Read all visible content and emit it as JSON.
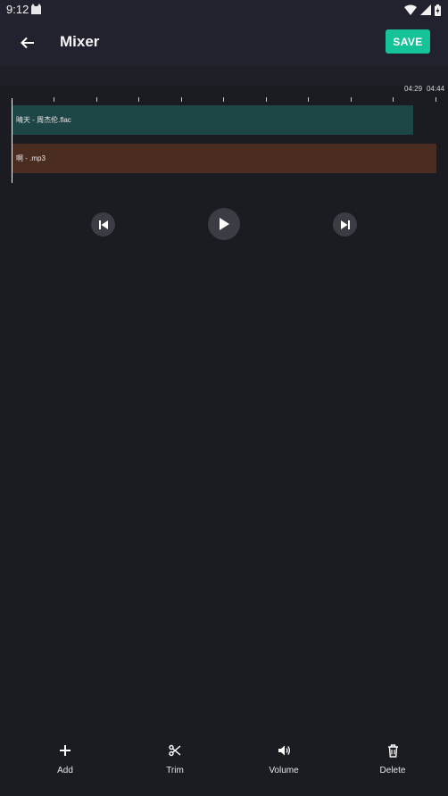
{
  "status_bar": {
    "time": "9:12"
  },
  "app_bar": {
    "title": "Mixer",
    "save_label": "SAVE"
  },
  "timeline": {
    "ruler_labels": [
      "04:29",
      "04:44"
    ],
    "tracks": [
      {
        "name": "晴天 - 周杰伦.flac",
        "color": "#1e4646"
      },
      {
        "name": "啊 - .mp3",
        "color": "#4a2c21"
      }
    ]
  },
  "transport": {
    "previous_icon": "skip-previous-icon",
    "play_icon": "play-icon",
    "next_icon": "skip-next-icon"
  },
  "bottom_nav": {
    "items": [
      {
        "label": "Add",
        "icon": "plus-icon"
      },
      {
        "label": "Trim",
        "icon": "scissors-icon"
      },
      {
        "label": "Volume",
        "icon": "volume-icon"
      },
      {
        "label": "Delete",
        "icon": "trash-icon"
      }
    ]
  },
  "colors": {
    "accent": "#16c399",
    "background": "#1b1c22",
    "app_bar": "#22212e"
  }
}
